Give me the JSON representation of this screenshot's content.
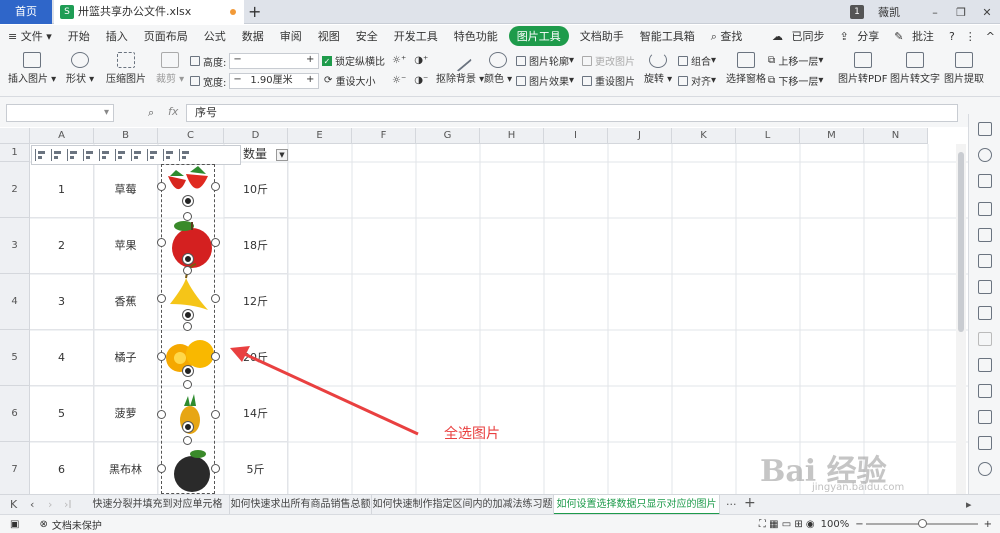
{
  "tabbar": {
    "home_label": "首页",
    "file_tab": "卅篮共享办公文件.xlsx",
    "user": "薇凯",
    "notif_count": "1"
  },
  "menubar": {
    "file_menu": "文件",
    "items": [
      "开始",
      "插入",
      "页面布局",
      "公式",
      "数据",
      "审阅",
      "视图",
      "安全",
      "开发工具",
      "特色功能",
      "图片工具",
      "文档助手",
      "智能工具箱"
    ],
    "active_index": 10,
    "search": "查找",
    "sync": "已同步",
    "share": "分享",
    "comment": "批注"
  },
  "ribbon": {
    "insert_pic": "插入图片",
    "shape": "形状",
    "compress": "压缩图片",
    "crop": "裁剪",
    "height_label": "高度:",
    "height_value": "",
    "width_label": "宽度:",
    "width_value": "1.90厘米",
    "lock_ratio": "锁定纵横比",
    "reset_size": "重设大小",
    "remove_bg": "抠除背景",
    "color": "颜色",
    "pic_outline": "图片轮廓",
    "pic_effect": "图片效果",
    "change_pic": "更改图片",
    "reset_pic": "重设图片",
    "rotate": "旋转",
    "group": "组合",
    "align": "对齐",
    "select_pane": "选择窗格",
    "bring_forward": "上移一层",
    "send_backward": "下移一层",
    "pic_to_pdf": "图片转PDF",
    "pic_to_text": "图片转文字",
    "pic_extract": "图片提取"
  },
  "formula": {
    "namebox": "",
    "fx": "fx",
    "content": "序号"
  },
  "grid": {
    "columns": [
      "A",
      "B",
      "C",
      "D",
      "E",
      "F",
      "G",
      "H",
      "I",
      "J",
      "K",
      "L",
      "M",
      "N"
    ],
    "row_numbers": [
      "1",
      "2",
      "3",
      "4",
      "5",
      "6",
      "7"
    ],
    "header_qty": "数量",
    "rows": [
      {
        "no": "1",
        "name": "草莓",
        "qty": "10斤"
      },
      {
        "no": "2",
        "name": "苹果",
        "qty": "18斤"
      },
      {
        "no": "3",
        "name": "香蕉",
        "qty": "12斤"
      },
      {
        "no": "4",
        "name": "橘子",
        "qty": "20斤"
      },
      {
        "no": "5",
        "name": "菠萝",
        "qty": "14斤"
      },
      {
        "no": "6",
        "name": "黑布林",
        "qty": "5斤"
      }
    ]
  },
  "annotation": "全选图片",
  "sheet_tabs": [
    "快速分裂并填充到对应单元格",
    "如何快速求出所有商品销售总额",
    "如何快速制作指定区间内的加减法练习题",
    "如何设置选择数据只显示对应的图片"
  ],
  "active_sheet_index": 3,
  "status": {
    "protect": "文档未保护",
    "zoom": "100%"
  },
  "watermark": "Bai 经验",
  "watermark_url": "jingyan.baidu.com",
  "colors": {
    "accent": "#1e9b4b",
    "home_tab": "#2f66c9",
    "annotation": "#e94040"
  }
}
